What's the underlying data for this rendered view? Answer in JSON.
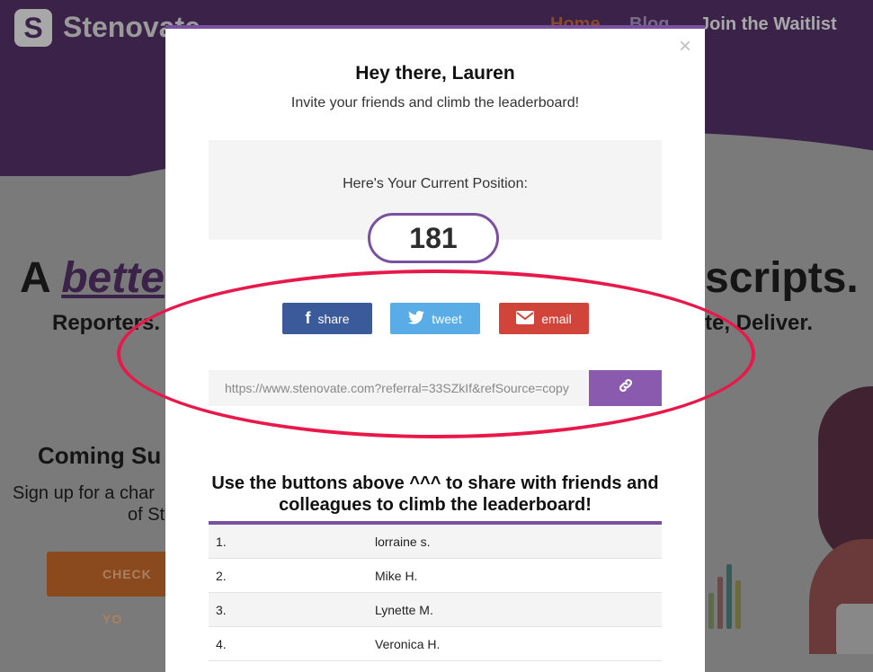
{
  "site": {
    "logo_letter": "S",
    "brand": "Stenovate",
    "nav": {
      "home": "Home",
      "blog": "Blog",
      "waitlist": "Join the Waitlist"
    },
    "hero_start": "A ",
    "hero_em": "bette",
    "hero_end": "scripts.",
    "sub_left": "Reporters.",
    "sub_right": "te, Deliver.",
    "coming": "Coming Su",
    "signup_line1": "Sign up for a char",
    "signup_line2": "of St",
    "check_btn": "CHECK YO"
  },
  "modal": {
    "close": "×",
    "title": "Hey there, Lauren",
    "subtitle": "Invite your friends and climb the leaderboard!",
    "position_label": "Here's Your Current Position:",
    "position": "181",
    "share": {
      "facebook": "share",
      "twitter": "tweet",
      "email": "email"
    },
    "referral_url": "https://www.stenovate.com?referral=33SZkIf&refSource=copy",
    "leaderboard_title": "Use the buttons above ^^^ to share with friends and colleagues to climb the leaderboard!",
    "leaderboard": [
      {
        "rank": "1.",
        "name": "lorraine s."
      },
      {
        "rank": "2.",
        "name": "Mike H."
      },
      {
        "rank": "3.",
        "name": "Lynette M."
      },
      {
        "rank": "4.",
        "name": "Veronica H."
      }
    ]
  },
  "colors": {
    "accent": "#7a50a0",
    "facebook": "#3b5a99",
    "twitter": "#5aace7",
    "email": "#d1443a",
    "annotation": "#e8194a"
  },
  "icons": {
    "facebook": "facebook-icon",
    "twitter": "twitter-icon",
    "email": "envelope-icon",
    "link": "link-icon",
    "close": "close-icon"
  }
}
